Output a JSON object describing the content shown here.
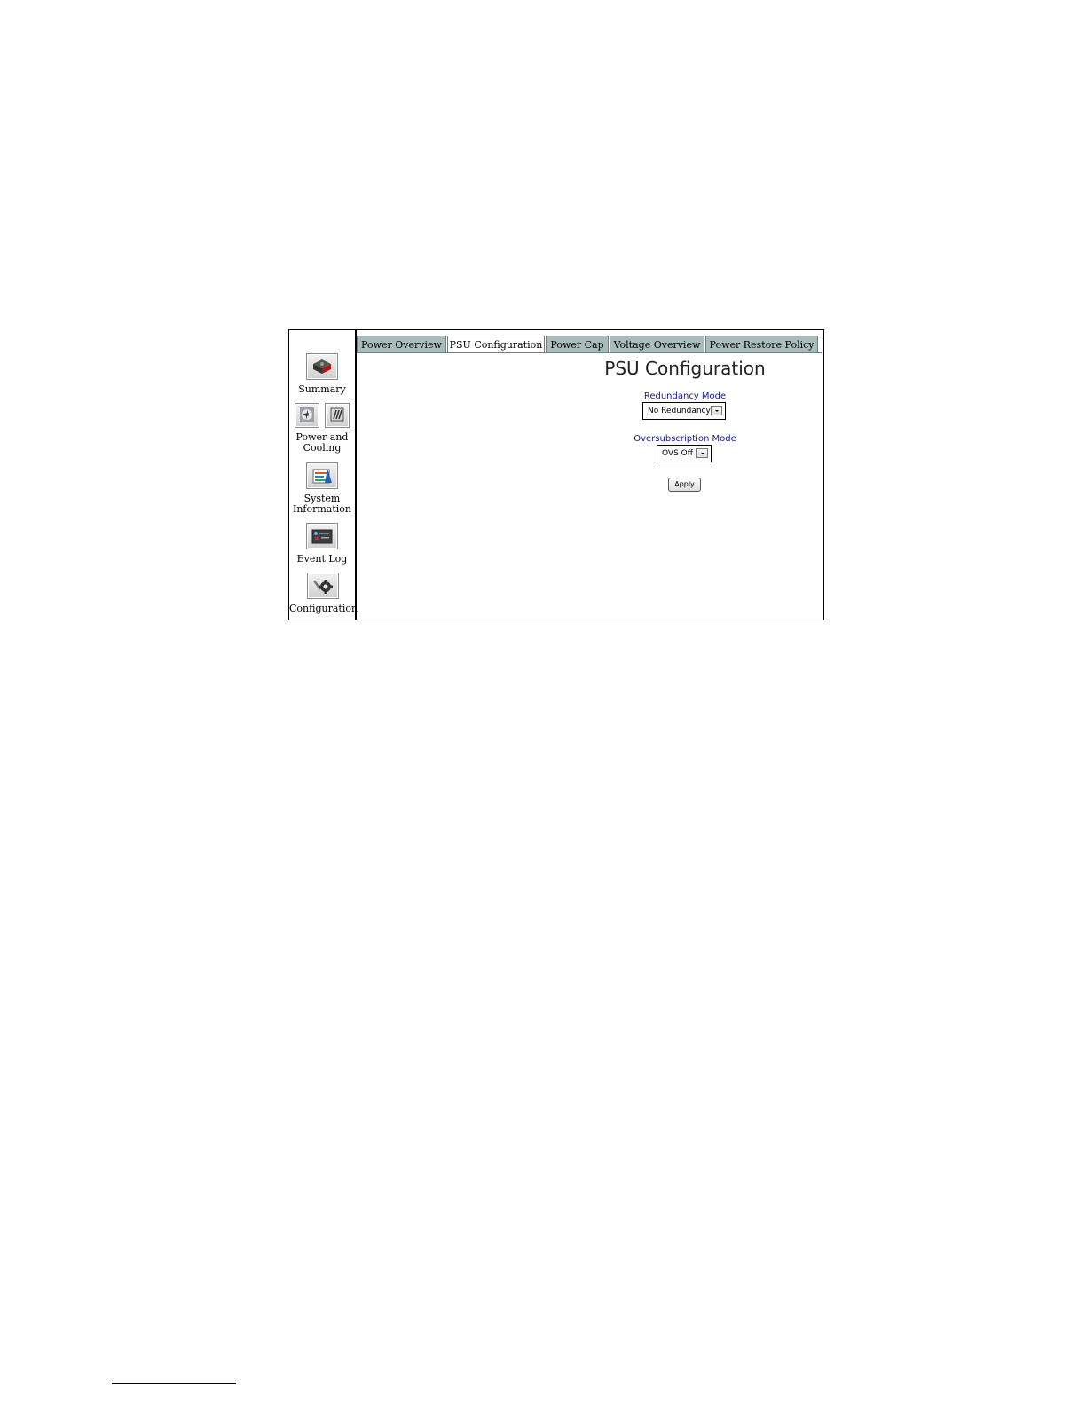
{
  "sidebar": {
    "items": [
      {
        "label": "Summary",
        "icon": "power-supply-icon"
      },
      {
        "label": "Power and\nCooling",
        "icon": "fan-icon"
      },
      {
        "label": "System\nInformation",
        "icon": "system-info-icon"
      },
      {
        "label": "Event Log",
        "icon": "event-log-icon"
      },
      {
        "label": "Configuration",
        "icon": "gear-wrench-icon"
      }
    ]
  },
  "tabs": [
    {
      "label": "Power Overview",
      "active": false
    },
    {
      "label": "PSU Configuration",
      "active": true
    },
    {
      "label": "Power Cap",
      "active": false
    },
    {
      "label": "Voltage Overview",
      "active": false
    },
    {
      "label": "Power Restore Policy",
      "active": false
    }
  ],
  "main": {
    "title": "PSU Configuration",
    "redundancy": {
      "label": "Redundancy Mode",
      "value": "No Redundancy"
    },
    "oversubscription": {
      "label": "Oversubscription Mode",
      "value": "OVS Off"
    },
    "apply_label": "Apply"
  },
  "colors": {
    "tab_bg": "#a9bcbc",
    "label_blue": "#1a1a8a"
  }
}
